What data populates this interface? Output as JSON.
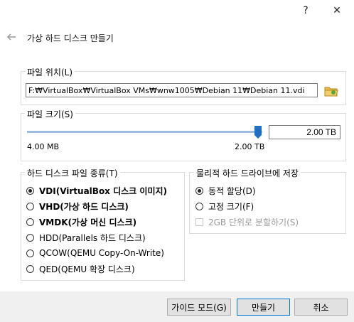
{
  "window": {
    "help_label": "?",
    "close_label": "✕"
  },
  "header": {
    "title": "가상 하드 디스크 만들기"
  },
  "location": {
    "legend": "파일 위치(L)",
    "path": "F:₩VirtualBox₩VirtualBox VMs₩wnw1005₩Debian 11₩Debian 11.vdi"
  },
  "size": {
    "legend": "파일 크기(S)",
    "value": "2.00 TB",
    "min_label": "4.00 MB",
    "max_label": "2.00 TB",
    "slider_fraction": 1.0
  },
  "file_type": {
    "legend": "하드 디스크 파일 종류(T)",
    "options": [
      {
        "label": "VDI(VirtualBox 디스크 이미지)",
        "selected": true,
        "bold": true
      },
      {
        "label": "VHD(가상 하드 디스크)",
        "selected": false,
        "bold": true
      },
      {
        "label": "VMDK(가상 머신 디스크)",
        "selected": false,
        "bold": true
      },
      {
        "label": "HDD(Parallels 하드 디스크)",
        "selected": false,
        "bold": false
      },
      {
        "label": "QCOW(QEMU Copy-On-Write)",
        "selected": false,
        "bold": false
      },
      {
        "label": "QED(QEMU 확장 디스크)",
        "selected": false,
        "bold": false
      }
    ]
  },
  "storage": {
    "legend": "물리적 하드 드라이브에 저장",
    "dynamic_label": "동적 할당(D)",
    "fixed_label": "고정 크기(F)",
    "split_label": "2GB 단위로 분할하기(S)",
    "dynamic_selected": true,
    "split_checked": false
  },
  "footer": {
    "guided_label": "가이드 모드(G)",
    "create_label": "만들기",
    "cancel_label": "취소"
  },
  "colors": {
    "accent": "#0078d7",
    "folder": "#e8b84a",
    "slider_thumb": "#1f6fc4"
  }
}
